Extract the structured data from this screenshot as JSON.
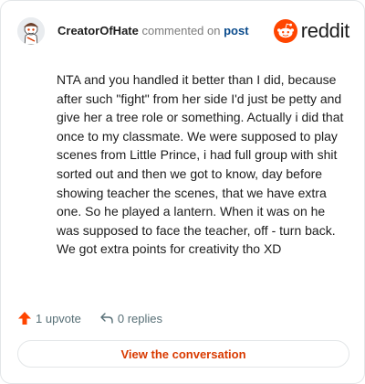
{
  "header": {
    "username": "CreatorOfHate",
    "commented_text": "commented on",
    "post_link": "post",
    "avatar_icon": "snoo-avatar-icon",
    "brand_icon": "reddit-snoo-icon",
    "brand_word": "reddit"
  },
  "comment": {
    "body": "NTA and you handled it better than I did, because after such \"fight\" from her side I'd just be petty and give her a tree role or something. Actually i did that once to my classmate. We were supposed to play scenes from Little Prince, i had full group with shit sorted out and then we got to know, day before showing teacher the scenes, that we have extra one. So he played a lantern. When it was on he was supposed to face the teacher, off - turn back. We got extra points for creativity tho XD"
  },
  "actions": {
    "upvote_icon": "upvote-arrow-icon",
    "upvote_label": "1 upvote",
    "reply_icon": "reply-arrow-icon",
    "replies_label": "0 replies"
  },
  "footer": {
    "view_label": "View the conversation"
  },
  "colors": {
    "brand_orange": "#ff4500",
    "link_blue": "#0a4b8c",
    "button_text": "#d93a00",
    "muted": "#576f76"
  }
}
